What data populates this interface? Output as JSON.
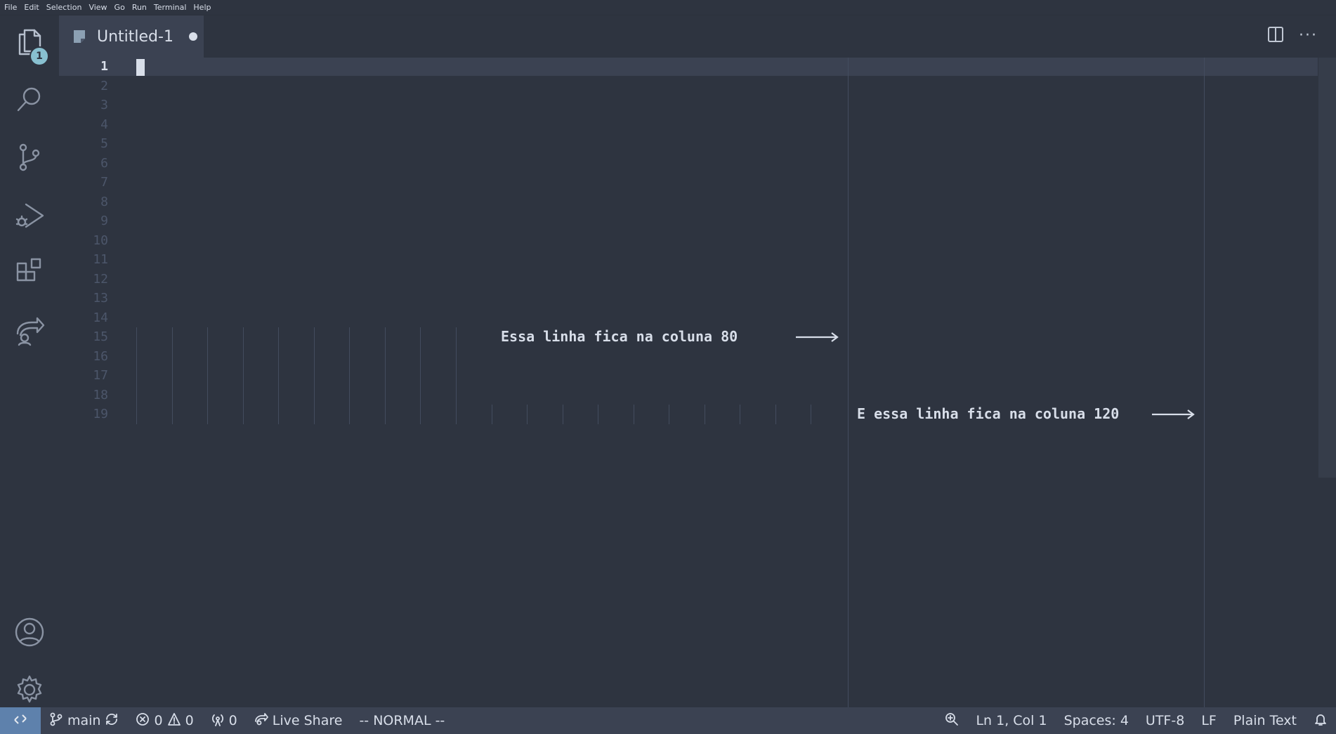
{
  "menu": [
    "File",
    "Edit",
    "Selection",
    "View",
    "Go",
    "Run",
    "Terminal",
    "Help"
  ],
  "activity": {
    "explorer_badge": "1",
    "items": [
      "files-icon",
      "search-icon",
      "source-control-icon",
      "run-debug-icon",
      "extensions-icon",
      "live-share-icon"
    ],
    "bottom": [
      "account-icon",
      "gear-icon"
    ]
  },
  "tab": {
    "title": "Untitled-1",
    "dirty": true
  },
  "editor": {
    "line_numbers": [
      "1",
      "2",
      "3",
      "4",
      "5",
      "6",
      "7",
      "8",
      "9",
      "10",
      "11",
      "12",
      "13",
      "14",
      "15",
      "16",
      "17",
      "18",
      "19"
    ],
    "current_line": "1",
    "line15_text": "Essa linha fica na coluna 80",
    "line19_text": "E essa linha fica na coluna 120"
  },
  "status": {
    "branch": "main",
    "errors": "0",
    "warnings": "0",
    "ports": "0",
    "live_share": "Live Share",
    "vim_mode": "-- NORMAL --",
    "position": "Ln 1, Col 1",
    "spaces": "Spaces: 4",
    "encoding": "UTF-8",
    "eol": "LF",
    "language": "Plain Text"
  },
  "colors": {
    "background": "#2e3440",
    "tab_active": "#3b4252",
    "accent": "#88c0d0",
    "remote": "#5e81ac",
    "text": "#d8dee9",
    "guides": "#434c5e"
  }
}
